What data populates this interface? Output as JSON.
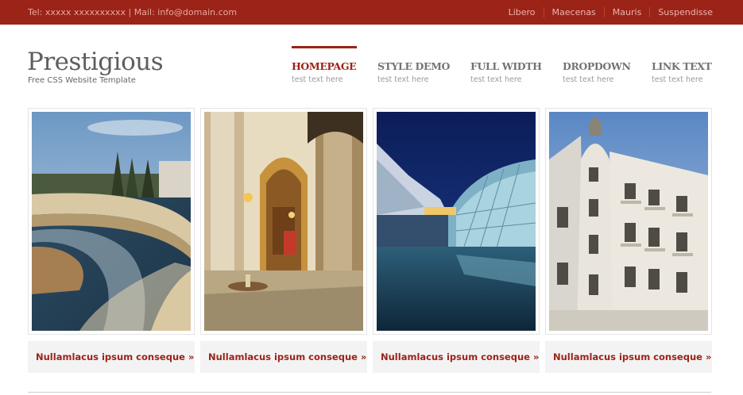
{
  "topbar": {
    "contact": "Tel: xxxxx xxxxxxxxxx | Mail: info@domain.com",
    "links": [
      "Libero",
      "Maecenas",
      "Mauris",
      "Suspendisse"
    ]
  },
  "logo": {
    "title": "Prestigious",
    "subtitle": "Free CSS Website Template"
  },
  "nav": [
    {
      "label": "HOMEPAGE",
      "sub": "test text here",
      "active": true
    },
    {
      "label": "STYLE DEMO",
      "sub": "test text here",
      "active": false
    },
    {
      "label": "FULL WIDTH",
      "sub": "test text here",
      "active": false
    },
    {
      "label": "DROPDOWN",
      "sub": "test text here",
      "active": false
    },
    {
      "label": "LINK TEXT",
      "sub": "test text here",
      "active": false
    }
  ],
  "gallery": [
    {
      "caption": "Nullamlacus ipsum conseque »"
    },
    {
      "caption": "Nullamlacus ipsum conseque »"
    },
    {
      "caption": "Nullamlacus ipsum conseque »"
    },
    {
      "caption": "Nullamlacus ipsum conseque »"
    }
  ],
  "colors": {
    "accent": "#9b2318",
    "topbar": "#9b2318",
    "caption_bg": "#f3f3f3"
  }
}
